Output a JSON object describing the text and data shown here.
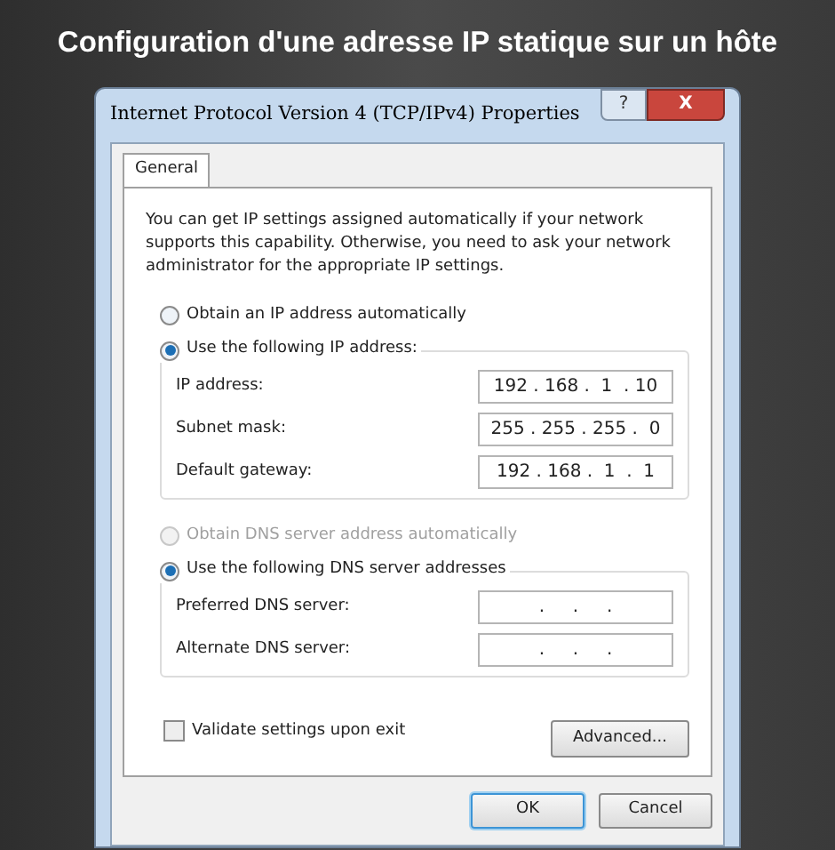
{
  "slide_title": "Configuration d'une adresse IP statique sur un hôte",
  "window": {
    "title": "Internet Protocol Version 4 (TCP/IPv4) Properties",
    "help": "?",
    "close": "X"
  },
  "tabs": [
    {
      "label": "General",
      "selected": true
    }
  ],
  "intro": "You can get IP settings assigned automatically if your network supports this capability. Otherwise, you need to ask your network administrator for the appropriate IP settings.",
  "ip_options": [
    {
      "label": "Obtain an IP address automatically",
      "selected": false,
      "disabled": false
    },
    {
      "label": "Use the following IP address:",
      "selected": true,
      "disabled": false
    }
  ],
  "ip_fields": [
    {
      "label": "IP address:",
      "value": "192 . 168 .  1  . 10"
    },
    {
      "label": "Subnet mask:",
      "value": "255 . 255 . 255 .  0"
    },
    {
      "label": "Default gateway:",
      "value": "192 . 168 .  1  .  1"
    }
  ],
  "dns_options": [
    {
      "label": "Obtain DNS server address automatically",
      "selected": false,
      "disabled": true
    },
    {
      "label": "Use the following DNS server addresses",
      "selected": true,
      "disabled": false
    }
  ],
  "dns_fields": [
    {
      "label": "Preferred DNS server:",
      "value": ".     .     ."
    },
    {
      "label": "Alternate DNS server:",
      "value": ".     .     ."
    }
  ],
  "validate": {
    "label": "Validate settings upon exit",
    "checked": false
  },
  "advanced_button": "Advanced...",
  "buttons": [
    {
      "label": "OK",
      "kind": "default"
    },
    {
      "label": "Cancel",
      "kind": "normal"
    }
  ]
}
